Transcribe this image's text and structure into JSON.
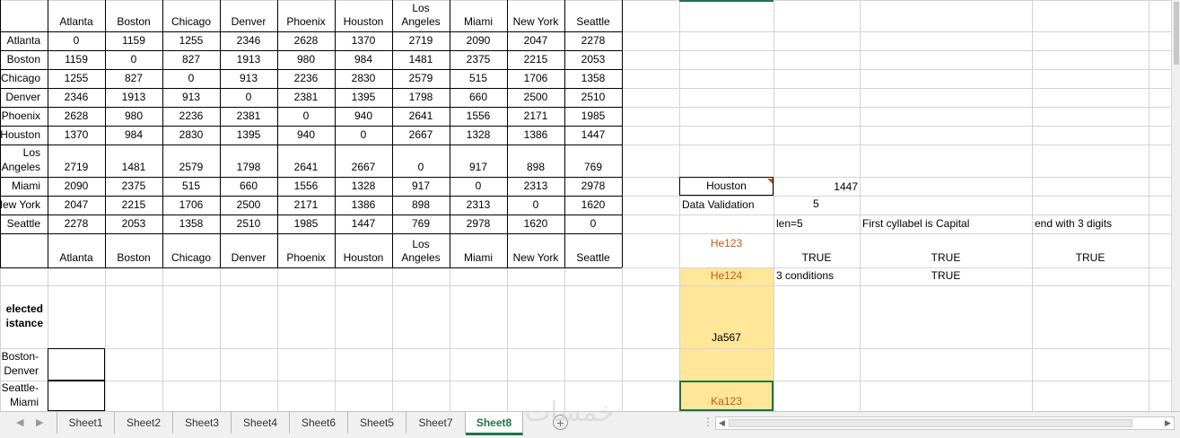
{
  "cities_header": [
    "Atlanta",
    "Boston",
    "Chicago",
    "Denver",
    "Phoenix",
    "Houston",
    "Los Angeles",
    "Miami",
    "New York",
    "Seattle"
  ],
  "row_labels": [
    "Atlanta",
    "Boston",
    "Chicago",
    "Denver",
    "Phoenix",
    "Houston",
    "Los Angeles",
    "Miami",
    "New York",
    "Seattle"
  ],
  "row_labels_visible": [
    "Atlanta",
    "Boston",
    "Chicago",
    "Denver",
    "Phoenix",
    "Houston",
    "Los\nAngeles",
    "Miami",
    "New York",
    "Seattle"
  ],
  "distances": [
    [
      "0",
      "1159",
      "1255",
      "2346",
      "2628",
      "1370",
      "2719",
      "2090",
      "2047",
      "2278"
    ],
    [
      "1159",
      "0",
      "827",
      "1913",
      "980",
      "984",
      "1481",
      "2375",
      "2215",
      "2053"
    ],
    [
      "1255",
      "827",
      "0",
      "913",
      "2236",
      "2830",
      "2579",
      "515",
      "1706",
      "1358"
    ],
    [
      "2346",
      "1913",
      "913",
      "0",
      "2381",
      "1395",
      "1798",
      "660",
      "2500",
      "2510"
    ],
    [
      "2628",
      "980",
      "2236",
      "2381",
      "0",
      "940",
      "2641",
      "1556",
      "2171",
      "1985"
    ],
    [
      "1370",
      "984",
      "2830",
      "1395",
      "940",
      "0",
      "2667",
      "1328",
      "1386",
      "1447"
    ],
    [
      "2719",
      "1481",
      "2579",
      "1798",
      "2641",
      "2667",
      "0",
      "917",
      "898",
      "769"
    ],
    [
      "2090",
      "2375",
      "515",
      "660",
      "1556",
      "1328",
      "917",
      "0",
      "2313",
      "2978"
    ],
    [
      "2047",
      "2215",
      "1706",
      "2500",
      "2171",
      "1386",
      "898",
      "2313",
      "0",
      "1620"
    ],
    [
      "2278",
      "2053",
      "1358",
      "2510",
      "1985",
      "1447",
      "769",
      "2978",
      "1620",
      "0"
    ]
  ],
  "selected_distance_label": "elected\nistance",
  "pair_labels": [
    "Boston-\nDenver",
    "Seattle-\nMiami"
  ],
  "right_panel": {
    "lookup_city": "Houston",
    "lookup_result": "1447",
    "data_validation_label": "Data Validation",
    "data_validation_value": "5",
    "headers": [
      "len=5",
      "First cyllabel is Capital",
      "end with 3 digits"
    ],
    "test_values": [
      "He123",
      "He124"
    ],
    "row1_results": [
      "TRUE",
      "TRUE",
      "TRUE"
    ],
    "three_conditions_label": "3 conditions",
    "row2_result": "TRUE",
    "sample_value": "Ja567",
    "selected_value": "Ka123"
  },
  "sheet_tabs": [
    "Sheet1",
    "Sheet2",
    "Sheet3",
    "Sheet4",
    "Sheet6",
    "Sheet5",
    "Sheet7",
    "Sheet8"
  ],
  "active_tab": "Sheet8",
  "watermark_text": "خمسات",
  "colors": {
    "accent": "#217346",
    "highlight": "#ffe699",
    "orange_text": "#c55a11",
    "gridline": "#d4d4d4"
  }
}
